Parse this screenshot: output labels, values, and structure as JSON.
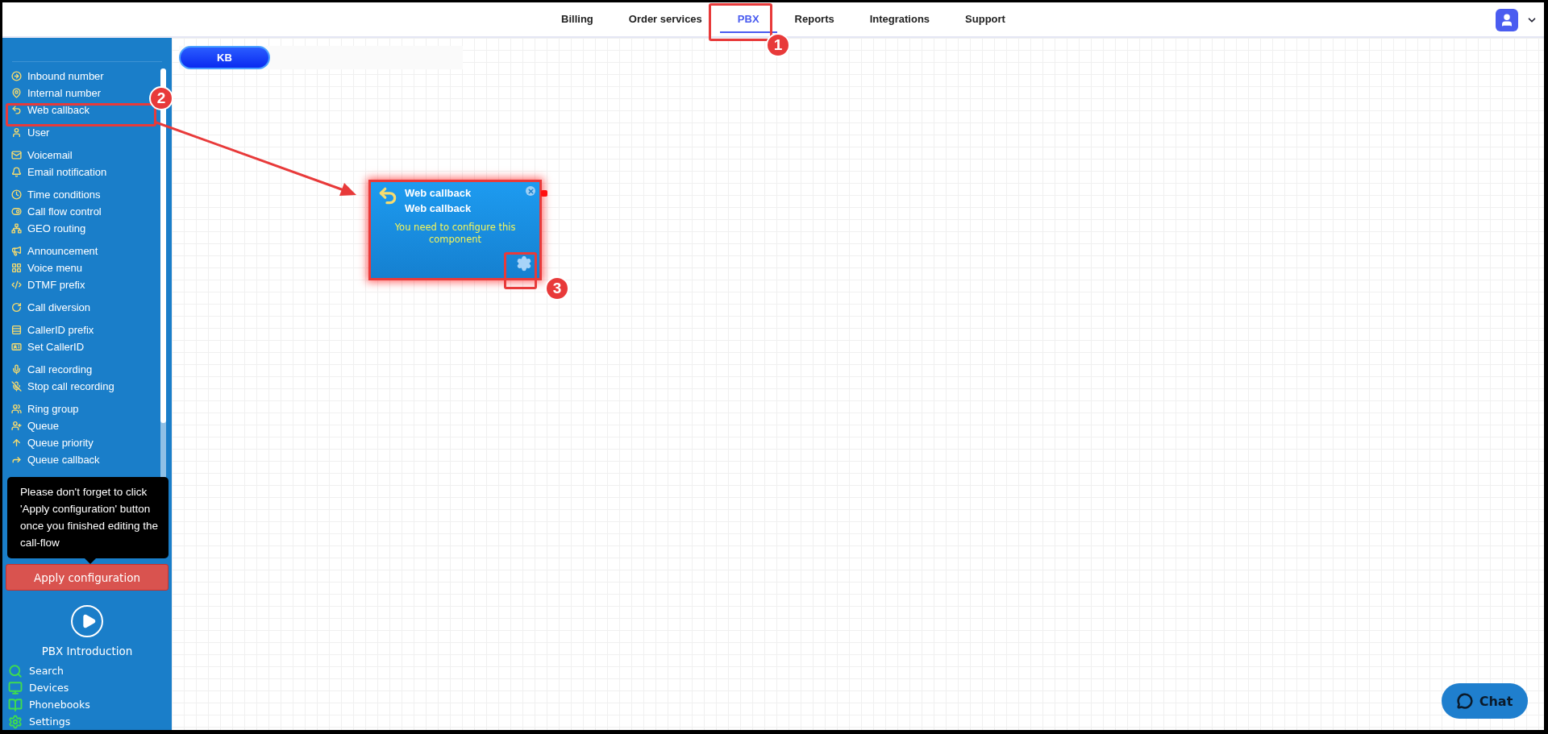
{
  "nav": {
    "tabs": [
      {
        "label": "Billing",
        "selected": false
      },
      {
        "label": "Order services",
        "selected": false
      },
      {
        "label": "PBX",
        "selected": true
      },
      {
        "label": "Reports",
        "selected": false
      },
      {
        "label": "Integrations",
        "selected": false
      },
      {
        "label": "Support",
        "selected": false
      }
    ]
  },
  "sidebar": {
    "groups": [
      {
        "items": [
          "Inbound number",
          "Internal number",
          "Web callback"
        ]
      },
      {
        "items": [
          "User"
        ]
      },
      {
        "items": [
          "Voicemail",
          "Email notification"
        ]
      },
      {
        "items": [
          "Time conditions",
          "Call flow control",
          "GEO routing"
        ]
      },
      {
        "items": [
          "Announcement",
          "Voice menu",
          "DTMF prefix"
        ]
      },
      {
        "items": [
          "Call diversion"
        ]
      },
      {
        "items": [
          "CallerID prefix",
          "Set CallerID"
        ]
      },
      {
        "items": [
          "Call recording",
          "Stop call recording"
        ]
      },
      {
        "items": [
          "Ring group",
          "Queue",
          "Queue priority",
          "Queue callback"
        ]
      }
    ],
    "tooltip": "Please don't forget to click 'Apply configuration' button once you finished editing the call-flow",
    "apply_button": "Apply configuration",
    "intro": "PBX Introduction",
    "tools": [
      "Search",
      "Devices",
      "Phonebooks",
      "Settings"
    ]
  },
  "canvas": {
    "kb_button": "KB",
    "node": {
      "title": "Web callback",
      "subtitle": "Web callback",
      "message": "You need to configure this component"
    }
  },
  "chat_button": "Chat",
  "annotations": [
    {
      "number": "1"
    },
    {
      "number": "2"
    },
    {
      "number": "3"
    }
  ]
}
